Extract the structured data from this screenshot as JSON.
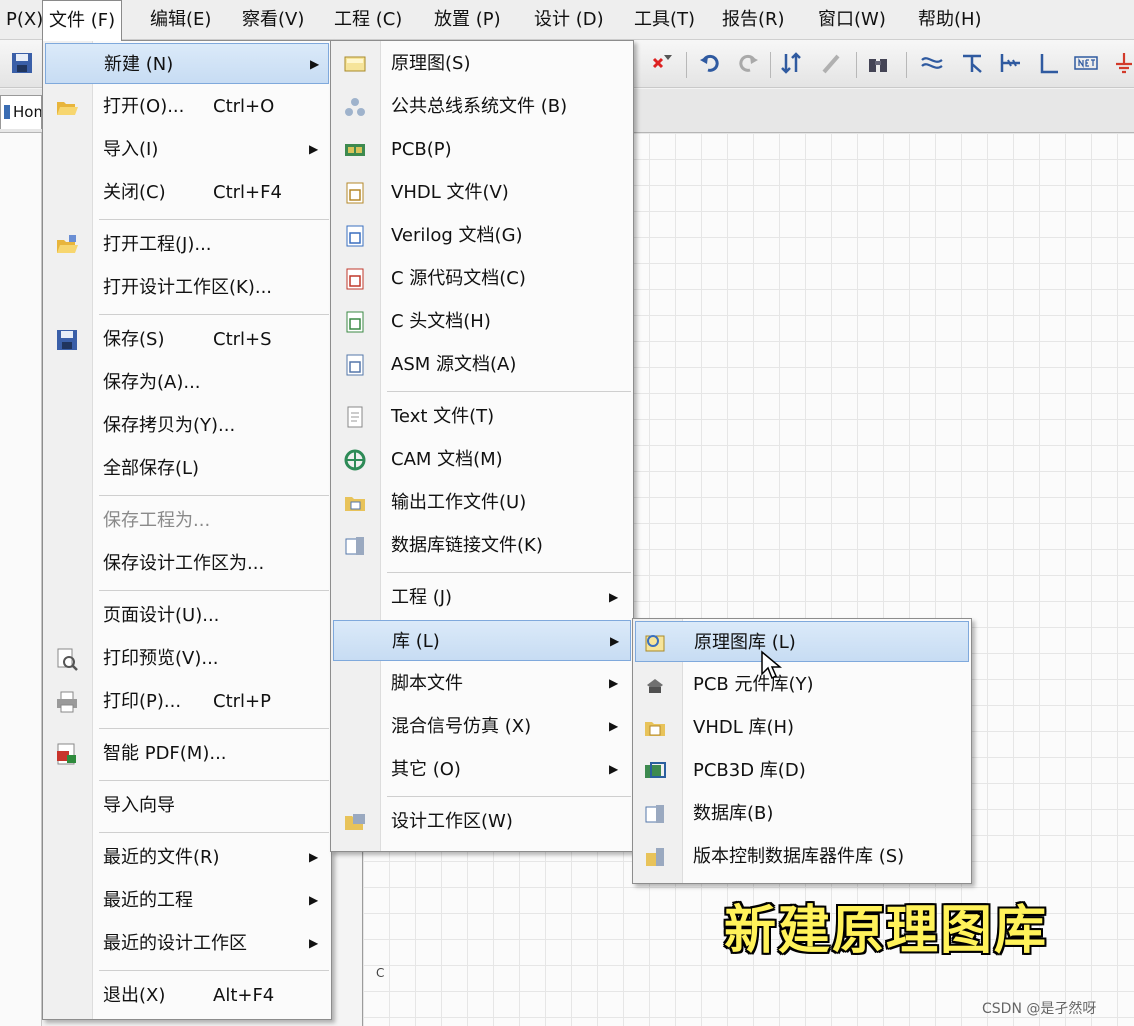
{
  "menubar": {
    "items": [
      {
        "label": "P(X)"
      },
      {
        "label": "文件 (F)"
      },
      {
        "label": "编辑(E)"
      },
      {
        "label": "察看(V)"
      },
      {
        "label": "工程 (C)"
      },
      {
        "label": "放置 (P)"
      },
      {
        "label": "设计 (D)"
      },
      {
        "label": "工具(T)"
      },
      {
        "label": "报告(R)"
      },
      {
        "label": "窗口(W)"
      },
      {
        "label": "帮助(H)"
      }
    ]
  },
  "tabs": {
    "home": "Hom"
  },
  "sheet_letter": "C",
  "file_menu": {
    "new": "新建 (N)",
    "open": "打开(O)...",
    "open_shortcut": "Ctrl+O",
    "import": "导入(I)",
    "close": "关闭(C)",
    "close_shortcut": "Ctrl+F4",
    "open_project": "打开工程(J)...",
    "open_workspace": "打开设计工作区(K)...",
    "save": "保存(S)",
    "save_shortcut": "Ctrl+S",
    "save_as": "保存为(A)...",
    "save_copy_as": "保存拷贝为(Y)...",
    "save_all": "全部保存(L)",
    "save_project_as": "保存工程为...",
    "save_workspace_as": "保存设计工作区为...",
    "page_setup": "页面设计(U)...",
    "print_preview": "打印预览(V)...",
    "print": "打印(P)...",
    "print_shortcut": "Ctrl+P",
    "smart_pdf": "智能 PDF(M)...",
    "import_wizard": "导入向导",
    "recent_files": "最近的文件(R)",
    "recent_projects": "最近的工程",
    "recent_workspaces": "最近的设计工作区",
    "exit": "退出(X)",
    "exit_shortcut": "Alt+F4"
  },
  "new_menu": {
    "schematic": "原理图(S)",
    "bus_file": "公共总线系统文件 (B)",
    "pcb": "PCB(P)",
    "vhdl": "VHDL 文件(V)",
    "verilog": "Verilog 文档(G)",
    "c_source": "C 源代码文档(C)",
    "c_header": "C 头文档(H)",
    "asm": "ASM 源文档(A)",
    "text": "Text  文件(T)",
    "cam": "CAM 文档(M)",
    "output_job": "输出工作文件(U)",
    "db_link": "数据库链接文件(K)",
    "project": "工程 (J)",
    "library": "库 (L)",
    "script": "脚本文件",
    "mixed_sim": "混合信号仿真 (X)",
    "other": "其它 (O)",
    "workspace": "设计工作区(W)"
  },
  "library_menu": {
    "schematic_lib": "原理图库 (L)",
    "pcb_lib": "PCB 元件库(Y)",
    "vhdl_lib": "VHDL 库(H)",
    "pcb3d_lib": "PCB3D 库(D)",
    "database_lib": "数据库(B)",
    "svn_db_lib": "版本控制数据库器件库 (S)"
  },
  "overlay": {
    "caption": "新建原理图库",
    "watermark": "CSDN @是孑然呀"
  },
  "colors": {
    "highlight_fill": "#c7dcf3",
    "highlight_border": "#7fa9dc",
    "caption_text": "#fff25a"
  }
}
